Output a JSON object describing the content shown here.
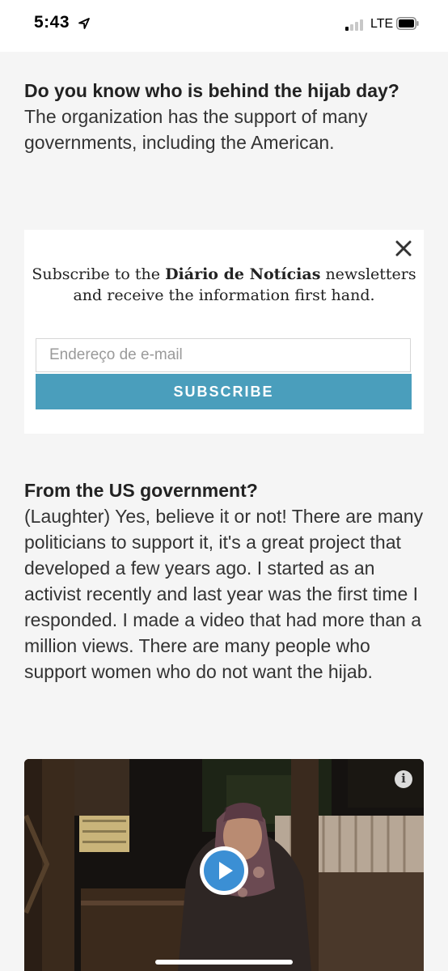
{
  "status_bar": {
    "time": "5:43",
    "network": "LTE",
    "signal_bars_active": 1,
    "signal_bars_total": 4
  },
  "article": {
    "q1": "Do you know who is behind the hijab day?",
    "a1": "The organization has the support of many governments, including the American.",
    "q2": "From the US government?",
    "a2": "(Laughter) Yes, believe it or not! There are many politicians to support it, it's a great project that developed a few years ago. I started as an activist recently and last year was the first time I responded. I made a video that had more than a million views. There are many people who support women who do not want the hijab."
  },
  "newsletter": {
    "text_before": "Subscribe to the ",
    "brand": "Diário de Notícias",
    "text_after": " newsletters and receive the information first hand.",
    "email_placeholder": "Endereço de e-mail",
    "subscribe_label": "SUBSCRIBE",
    "close_icon": "close-icon",
    "button_color": "#4a9ebc"
  },
  "video": {
    "play_icon": "play-icon",
    "info_icon": "info-icon",
    "info_glyph": "i"
  }
}
